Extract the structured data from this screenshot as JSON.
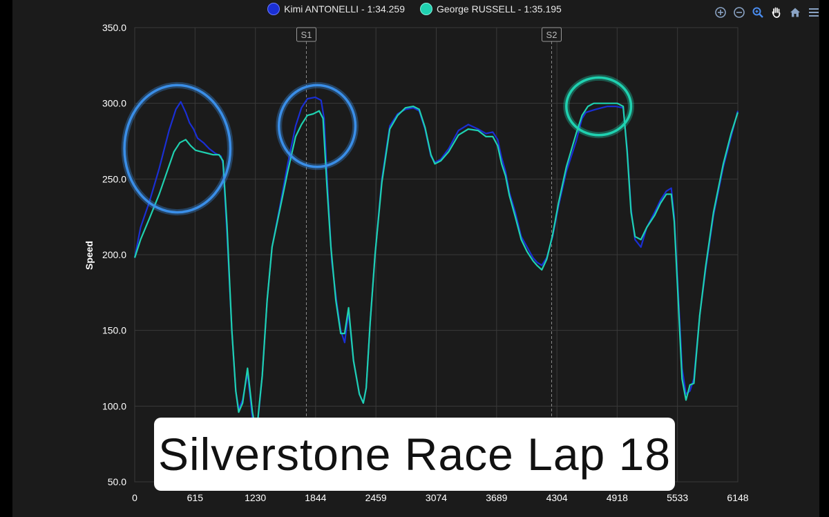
{
  "legend": [
    {
      "label": "Kimi ANTONELLI - 1:34.259",
      "color": "#1a2fd4"
    },
    {
      "label": "George RUSSELL - 1:35.195",
      "color": "#1fd1b0"
    }
  ],
  "toolbar": [
    "zoom-in-icon",
    "zoom-out-icon",
    "zoom-select-icon",
    "pan-hand-icon",
    "home-icon",
    "menu-icon"
  ],
  "caption": "Silverstone Race Lap 18",
  "colors": {
    "background": "#1b1b1b",
    "grid": "#3a3a3a",
    "axis_text": "#ffffff",
    "highlight_circle": "#3a8ee8",
    "highlight_circle_teal": "#1fd1b0"
  },
  "chart_data": {
    "type": "line",
    "title": "",
    "xlabel": "",
    "ylabel": "Speed",
    "xlim": [
      0,
      6148
    ],
    "ylim": [
      50,
      350
    ],
    "x_ticks": [
      "0",
      "615",
      "1230",
      "1844",
      "2459",
      "3074",
      "3689",
      "4304",
      "4918",
      "5533",
      "6148"
    ],
    "y_ticks": [
      "50.0",
      "100.0",
      "150.0",
      "200.0",
      "250.0",
      "300.0",
      "350.0"
    ],
    "grid": true,
    "legend_position": "top-center",
    "markers": [
      {
        "label": "S1",
        "x": 1750
      },
      {
        "label": "S2",
        "x": 4250
      }
    ],
    "series": [
      {
        "name": "Kimi ANTONELLI - 1:34.259",
        "color": "#1a2fd4",
        "points": [
          [
            0,
            198
          ],
          [
            60,
            218
          ],
          [
            150,
            235
          ],
          [
            250,
            257
          ],
          [
            350,
            282
          ],
          [
            420,
            296
          ],
          [
            470,
            301
          ],
          [
            520,
            294
          ],
          [
            560,
            287
          ],
          [
            600,
            283
          ],
          [
            640,
            277
          ],
          [
            700,
            274
          ],
          [
            760,
            270
          ],
          [
            820,
            267
          ],
          [
            880,
            265
          ],
          [
            900,
            260
          ],
          [
            940,
            215
          ],
          [
            990,
            150
          ],
          [
            1030,
            110
          ],
          [
            1060,
            98
          ],
          [
            1100,
            104
          ],
          [
            1150,
            122
          ],
          [
            1200,
            92
          ],
          [
            1240,
            80
          ],
          [
            1300,
            120
          ],
          [
            1350,
            170
          ],
          [
            1400,
            205
          ],
          [
            1480,
            232
          ],
          [
            1560,
            260
          ],
          [
            1640,
            285
          ],
          [
            1700,
            297
          ],
          [
            1760,
            303
          ],
          [
            1840,
            304
          ],
          [
            1900,
            302
          ],
          [
            1930,
            290
          ],
          [
            1970,
            240
          ],
          [
            2010,
            195
          ],
          [
            2060,
            168
          ],
          [
            2100,
            150
          ],
          [
            2140,
            142
          ],
          [
            2180,
            162
          ],
          [
            2230,
            130
          ],
          [
            2290,
            108
          ],
          [
            2330,
            102
          ],
          [
            2360,
            112
          ],
          [
            2400,
            155
          ],
          [
            2450,
            200
          ],
          [
            2520,
            250
          ],
          [
            2600,
            285
          ],
          [
            2680,
            293
          ],
          [
            2760,
            296
          ],
          [
            2840,
            297
          ],
          [
            2900,
            295
          ],
          [
            2960,
            283
          ],
          [
            3020,
            265
          ],
          [
            3060,
            261
          ],
          [
            3120,
            263
          ],
          [
            3200,
            270
          ],
          [
            3300,
            282
          ],
          [
            3400,
            286
          ],
          [
            3500,
            283
          ],
          [
            3580,
            280
          ],
          [
            3650,
            281
          ],
          [
            3700,
            276
          ],
          [
            3740,
            264
          ],
          [
            3780,
            255
          ],
          [
            3820,
            241
          ],
          [
            3880,
            228
          ],
          [
            3940,
            212
          ],
          [
            4000,
            205
          ],
          [
            4060,
            198
          ],
          [
            4100,
            195
          ],
          [
            4150,
            193
          ],
          [
            4200,
            198
          ],
          [
            4260,
            212
          ],
          [
            4320,
            232
          ],
          [
            4400,
            255
          ],
          [
            4500,
            275
          ],
          [
            4560,
            290
          ],
          [
            4600,
            294
          ],
          [
            4650,
            295
          ],
          [
            4700,
            296
          ],
          [
            4760,
            297
          ],
          [
            4820,
            298
          ],
          [
            4900,
            298
          ],
          [
            4980,
            297
          ],
          [
            5020,
            270
          ],
          [
            5060,
            230
          ],
          [
            5100,
            210
          ],
          [
            5160,
            205
          ],
          [
            5220,
            218
          ],
          [
            5300,
            228
          ],
          [
            5360,
            236
          ],
          [
            5420,
            242
          ],
          [
            5470,
            244
          ],
          [
            5500,
            225
          ],
          [
            5540,
            175
          ],
          [
            5580,
            125
          ],
          [
            5620,
            108
          ],
          [
            5660,
            110
          ],
          [
            5700,
            118
          ],
          [
            5760,
            160
          ],
          [
            5820,
            190
          ],
          [
            5900,
            226
          ],
          [
            6000,
            258
          ],
          [
            6080,
            278
          ],
          [
            6148,
            295
          ]
        ]
      },
      {
        "name": "George RUSSELL - 1:35.195",
        "color": "#1fd1b0",
        "points": [
          [
            0,
            198
          ],
          [
            60,
            210
          ],
          [
            150,
            224
          ],
          [
            250,
            240
          ],
          [
            330,
            255
          ],
          [
            400,
            268
          ],
          [
            460,
            274
          ],
          [
            520,
            276
          ],
          [
            570,
            272
          ],
          [
            620,
            269
          ],
          [
            680,
            268
          ],
          [
            740,
            267
          ],
          [
            800,
            266
          ],
          [
            860,
            266
          ],
          [
            900,
            262
          ],
          [
            940,
            220
          ],
          [
            990,
            150
          ],
          [
            1030,
            110
          ],
          [
            1060,
            96
          ],
          [
            1100,
            102
          ],
          [
            1150,
            125
          ],
          [
            1200,
            96
          ],
          [
            1240,
            82
          ],
          [
            1300,
            120
          ],
          [
            1350,
            170
          ],
          [
            1400,
            205
          ],
          [
            1480,
            230
          ],
          [
            1560,
            255
          ],
          [
            1640,
            278
          ],
          [
            1700,
            286
          ],
          [
            1760,
            292
          ],
          [
            1820,
            293
          ],
          [
            1880,
            295
          ],
          [
            1920,
            290
          ],
          [
            1960,
            245
          ],
          [
            2000,
            205
          ],
          [
            2050,
            170
          ],
          [
            2100,
            148
          ],
          [
            2140,
            148
          ],
          [
            2180,
            165
          ],
          [
            2230,
            130
          ],
          [
            2290,
            108
          ],
          [
            2330,
            102
          ],
          [
            2360,
            112
          ],
          [
            2400,
            155
          ],
          [
            2450,
            200
          ],
          [
            2520,
            248
          ],
          [
            2600,
            283
          ],
          [
            2680,
            292
          ],
          [
            2760,
            297
          ],
          [
            2840,
            298
          ],
          [
            2900,
            296
          ],
          [
            2960,
            284
          ],
          [
            3020,
            266
          ],
          [
            3060,
            260
          ],
          [
            3120,
            262
          ],
          [
            3200,
            268
          ],
          [
            3300,
            279
          ],
          [
            3400,
            283
          ],
          [
            3500,
            282
          ],
          [
            3580,
            278
          ],
          [
            3650,
            278
          ],
          [
            3700,
            272
          ],
          [
            3740,
            260
          ],
          [
            3780,
            252
          ],
          [
            3820,
            239
          ],
          [
            3880,
            225
          ],
          [
            3940,
            210
          ],
          [
            4000,
            202
          ],
          [
            4060,
            196
          ],
          [
            4100,
            193
          ],
          [
            4150,
            190
          ],
          [
            4200,
            197
          ],
          [
            4260,
            213
          ],
          [
            4320,
            234
          ],
          [
            4400,
            258
          ],
          [
            4500,
            280
          ],
          [
            4560,
            292
          ],
          [
            4620,
            298
          ],
          [
            4680,
            300
          ],
          [
            4760,
            300
          ],
          [
            4840,
            300
          ],
          [
            4920,
            300
          ],
          [
            4980,
            298
          ],
          [
            5020,
            268
          ],
          [
            5060,
            228
          ],
          [
            5100,
            212
          ],
          [
            5160,
            210
          ],
          [
            5220,
            218
          ],
          [
            5300,
            226
          ],
          [
            5360,
            234
          ],
          [
            5420,
            240
          ],
          [
            5470,
            240
          ],
          [
            5500,
            222
          ],
          [
            5540,
            170
          ],
          [
            5580,
            118
          ],
          [
            5620,
            104
          ],
          [
            5660,
            114
          ],
          [
            5700,
            115
          ],
          [
            5760,
            160
          ],
          [
            5820,
            192
          ],
          [
            5900,
            228
          ],
          [
            6000,
            260
          ],
          [
            6080,
            280
          ],
          [
            6148,
            294
          ]
        ]
      }
    ],
    "annotations": [
      {
        "type": "circle",
        "cx": 435,
        "cy": 270,
        "rx_units": 540,
        "ry_units": 42,
        "color": "#3a8ee8"
      },
      {
        "type": "circle",
        "cx": 1860,
        "cy": 285,
        "rx_units": 390,
        "ry_units": 27,
        "color": "#3a8ee8"
      },
      {
        "type": "circle",
        "cx": 4730,
        "cy": 298,
        "rx_units": 330,
        "ry_units": 19,
        "color": "#1fd1b0"
      }
    ]
  }
}
